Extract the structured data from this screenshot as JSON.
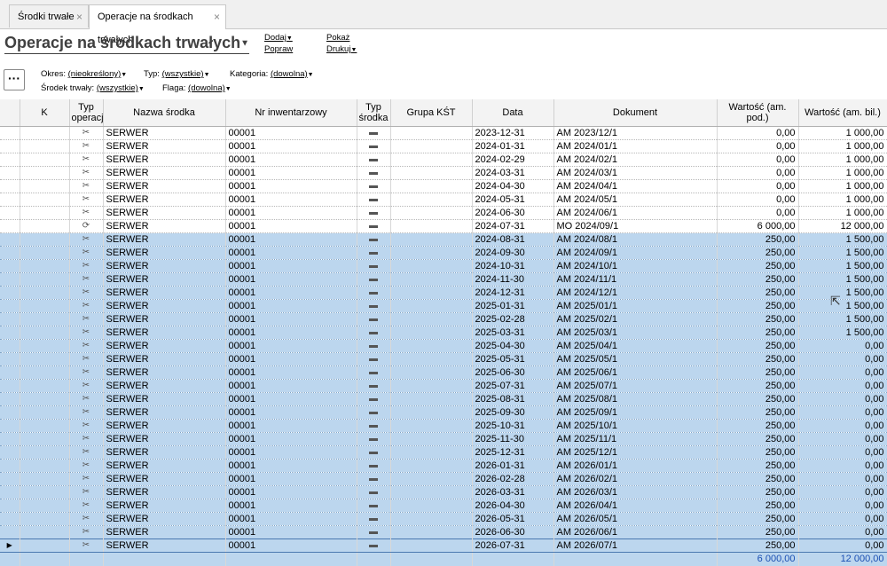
{
  "tabs": [
    {
      "label": "Środki trwałe"
    },
    {
      "label": "Operacje na środkach trwałych"
    }
  ],
  "page": {
    "title": "Operacje na środkach trwałych",
    "actions": {
      "add": "Dodaj",
      "edit": "Popraw",
      "show": "Pokaż",
      "print": "Drukuj"
    }
  },
  "filters": {
    "period_label": "Okres:",
    "period_value": "(nieokreślony)",
    "type_label": "Typ:",
    "type_value": "(wszystkie)",
    "category_label": "Kategoria:",
    "category_value": "(dowolna)",
    "asset_label": "Środek trwały:",
    "asset_value": "(wszystkie)",
    "flag_label": "Flaga:",
    "flag_value": "(dowolna)"
  },
  "columns": [
    "K",
    "Typ operacji",
    "Nazwa środka",
    "Nr inwentarzowy",
    "Typ środka",
    "Grupa KŚT",
    "Data",
    "Dokument",
    "Wartość (am. pod.)",
    "Wartość (am. bil.)"
  ],
  "rows": [
    {
      "op": "am",
      "name": "SERWER",
      "inv": "00001",
      "date": "2023-12-31",
      "doc": "AM 2023/12/1",
      "v1": "0,00",
      "v2": "1 000,00",
      "sel": false
    },
    {
      "op": "am",
      "name": "SERWER",
      "inv": "00001",
      "date": "2024-01-31",
      "doc": "AM 2024/01/1",
      "v1": "0,00",
      "v2": "1 000,00",
      "sel": false
    },
    {
      "op": "am",
      "name": "SERWER",
      "inv": "00001",
      "date": "2024-02-29",
      "doc": "AM 2024/02/1",
      "v1": "0,00",
      "v2": "1 000,00",
      "sel": false
    },
    {
      "op": "am",
      "name": "SERWER",
      "inv": "00001",
      "date": "2024-03-31",
      "doc": "AM 2024/03/1",
      "v1": "0,00",
      "v2": "1 000,00",
      "sel": false
    },
    {
      "op": "am",
      "name": "SERWER",
      "inv": "00001",
      "date": "2024-04-30",
      "doc": "AM 2024/04/1",
      "v1": "0,00",
      "v2": "1 000,00",
      "sel": false
    },
    {
      "op": "am",
      "name": "SERWER",
      "inv": "00001",
      "date": "2024-05-31",
      "doc": "AM 2024/05/1",
      "v1": "0,00",
      "v2": "1 000,00",
      "sel": false
    },
    {
      "op": "am",
      "name": "SERWER",
      "inv": "00001",
      "date": "2024-06-30",
      "doc": "AM 2024/06/1",
      "v1": "0,00",
      "v2": "1 000,00",
      "sel": false
    },
    {
      "op": "mo",
      "name": "SERWER",
      "inv": "00001",
      "date": "2024-07-31",
      "doc": "MO 2024/09/1",
      "v1": "6 000,00",
      "v2": "12 000,00",
      "sel": false
    },
    {
      "op": "am",
      "name": "SERWER",
      "inv": "00001",
      "date": "2024-08-31",
      "doc": "AM 2024/08/1",
      "v1": "250,00",
      "v2": "1 500,00",
      "sel": true
    },
    {
      "op": "am",
      "name": "SERWER",
      "inv": "00001",
      "date": "2024-09-30",
      "doc": "AM 2024/09/1",
      "v1": "250,00",
      "v2": "1 500,00",
      "sel": true
    },
    {
      "op": "am",
      "name": "SERWER",
      "inv": "00001",
      "date": "2024-10-31",
      "doc": "AM 2024/10/1",
      "v1": "250,00",
      "v2": "1 500,00",
      "sel": true
    },
    {
      "op": "am",
      "name": "SERWER",
      "inv": "00001",
      "date": "2024-11-30",
      "doc": "AM 2024/11/1",
      "v1": "250,00",
      "v2": "1 500,00",
      "sel": true
    },
    {
      "op": "am",
      "name": "SERWER",
      "inv": "00001",
      "date": "2024-12-31",
      "doc": "AM 2024/12/1",
      "v1": "250,00",
      "v2": "1 500,00",
      "sel": true
    },
    {
      "op": "am",
      "name": "SERWER",
      "inv": "00001",
      "date": "2025-01-31",
      "doc": "AM 2025/01/1",
      "v1": "250,00",
      "v2": "1 500,00",
      "sel": true
    },
    {
      "op": "am",
      "name": "SERWER",
      "inv": "00001",
      "date": "2025-02-28",
      "doc": "AM 2025/02/1",
      "v1": "250,00",
      "v2": "1 500,00",
      "sel": true
    },
    {
      "op": "am",
      "name": "SERWER",
      "inv": "00001",
      "date": "2025-03-31",
      "doc": "AM 2025/03/1",
      "v1": "250,00",
      "v2": "1 500,00",
      "sel": true
    },
    {
      "op": "am",
      "name": "SERWER",
      "inv": "00001",
      "date": "2025-04-30",
      "doc": "AM 2025/04/1",
      "v1": "250,00",
      "v2": "0,00",
      "sel": true
    },
    {
      "op": "am",
      "name": "SERWER",
      "inv": "00001",
      "date": "2025-05-31",
      "doc": "AM 2025/05/1",
      "v1": "250,00",
      "v2": "0,00",
      "sel": true
    },
    {
      "op": "am",
      "name": "SERWER",
      "inv": "00001",
      "date": "2025-06-30",
      "doc": "AM 2025/06/1",
      "v1": "250,00",
      "v2": "0,00",
      "sel": true
    },
    {
      "op": "am",
      "name": "SERWER",
      "inv": "00001",
      "date": "2025-07-31",
      "doc": "AM 2025/07/1",
      "v1": "250,00",
      "v2": "0,00",
      "sel": true
    },
    {
      "op": "am",
      "name": "SERWER",
      "inv": "00001",
      "date": "2025-08-31",
      "doc": "AM 2025/08/1",
      "v1": "250,00",
      "v2": "0,00",
      "sel": true
    },
    {
      "op": "am",
      "name": "SERWER",
      "inv": "00001",
      "date": "2025-09-30",
      "doc": "AM 2025/09/1",
      "v1": "250,00",
      "v2": "0,00",
      "sel": true
    },
    {
      "op": "am",
      "name": "SERWER",
      "inv": "00001",
      "date": "2025-10-31",
      "doc": "AM 2025/10/1",
      "v1": "250,00",
      "v2": "0,00",
      "sel": true
    },
    {
      "op": "am",
      "name": "SERWER",
      "inv": "00001",
      "date": "2025-11-30",
      "doc": "AM 2025/11/1",
      "v1": "250,00",
      "v2": "0,00",
      "sel": true
    },
    {
      "op": "am",
      "name": "SERWER",
      "inv": "00001",
      "date": "2025-12-31",
      "doc": "AM 2025/12/1",
      "v1": "250,00",
      "v2": "0,00",
      "sel": true
    },
    {
      "op": "am",
      "name": "SERWER",
      "inv": "00001",
      "date": "2026-01-31",
      "doc": "AM 2026/01/1",
      "v1": "250,00",
      "v2": "0,00",
      "sel": true
    },
    {
      "op": "am",
      "name": "SERWER",
      "inv": "00001",
      "date": "2026-02-28",
      "doc": "AM 2026/02/1",
      "v1": "250,00",
      "v2": "0,00",
      "sel": true
    },
    {
      "op": "am",
      "name": "SERWER",
      "inv": "00001",
      "date": "2026-03-31",
      "doc": "AM 2026/03/1",
      "v1": "250,00",
      "v2": "0,00",
      "sel": true
    },
    {
      "op": "am",
      "name": "SERWER",
      "inv": "00001",
      "date": "2026-04-30",
      "doc": "AM 2026/04/1",
      "v1": "250,00",
      "v2": "0,00",
      "sel": true
    },
    {
      "op": "am",
      "name": "SERWER",
      "inv": "00001",
      "date": "2026-05-31",
      "doc": "AM 2026/05/1",
      "v1": "250,00",
      "v2": "0,00",
      "sel": true
    },
    {
      "op": "am",
      "name": "SERWER",
      "inv": "00001",
      "date": "2026-06-30",
      "doc": "AM 2026/06/1",
      "v1": "250,00",
      "v2": "0,00",
      "sel": true
    },
    {
      "op": "am",
      "name": "SERWER",
      "inv": "00001",
      "date": "2026-07-31",
      "doc": "AM 2026/07/1",
      "v1": "250,00",
      "v2": "0,00",
      "sel": true,
      "current": true
    }
  ],
  "totals": {
    "v1": "6 000,00",
    "v2": "12 000,00"
  },
  "icons": {
    "op_am": "scissors-icon",
    "op_mo": "refresh-icon",
    "asset_type": "computer-icon"
  },
  "colors": {
    "selection": "#bcd6ee",
    "totals_text": "#1a4fb3"
  }
}
